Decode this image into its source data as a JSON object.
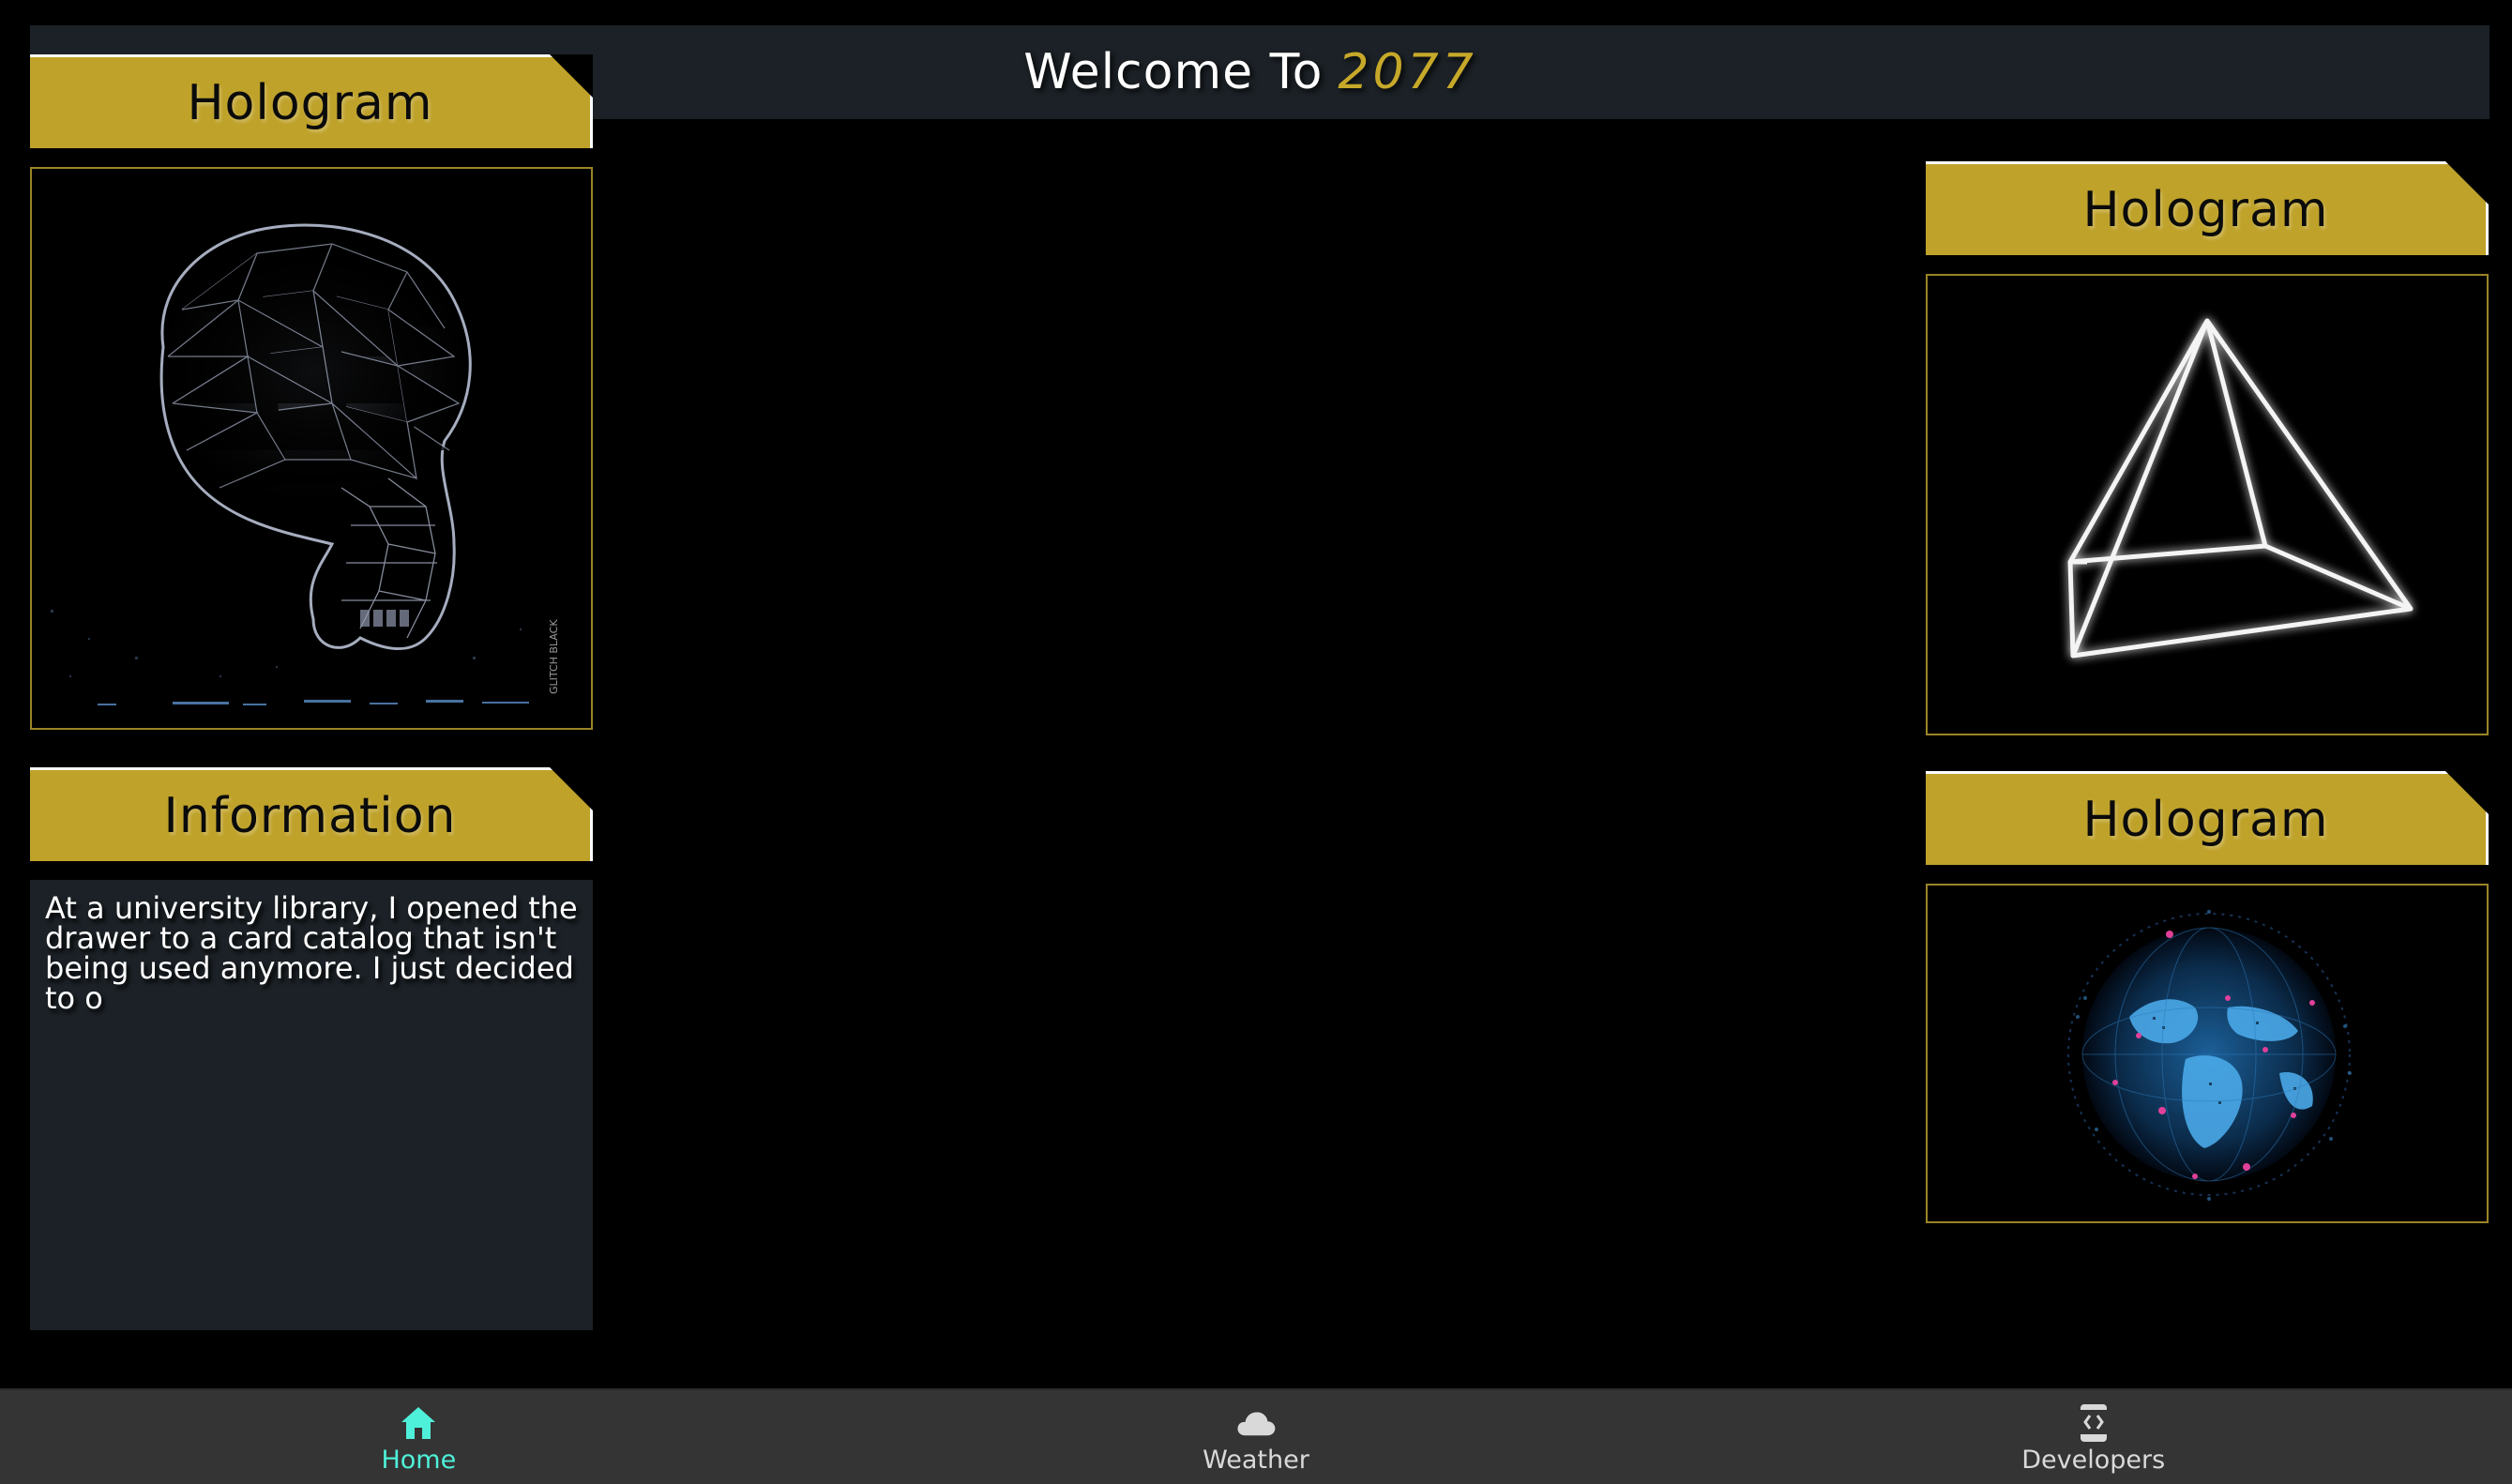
{
  "title": {
    "prefix": "Welcome To",
    "year": "2077"
  },
  "left_panel": {
    "hologram_header": "Hologram",
    "hologram_image": "wireframe-skull",
    "hologram_watermark": "GLITCH BLACK",
    "info_header": "Information",
    "info_text": "At a university library, I opened the drawer to a card catalog that isn't being used anymore. I just decided to o"
  },
  "right_panel": {
    "hologram_top_header": "Hologram",
    "hologram_top_image": "wireframe-pyramid",
    "hologram_bottom_header": "Hologram",
    "hologram_bottom_image": "digital-globe"
  },
  "nav": {
    "items": [
      {
        "label": "Home",
        "icon": "home-icon",
        "active": true
      },
      {
        "label": "Weather",
        "icon": "cloud-icon",
        "active": false
      },
      {
        "label": "Developers",
        "icon": "code-file-icon",
        "active": false
      }
    ]
  },
  "colors": {
    "accent_gold": "#bfa22a",
    "active_nav": "#4ff0d9",
    "panel_dark": "#1b2126",
    "nav_bg": "#343434"
  }
}
